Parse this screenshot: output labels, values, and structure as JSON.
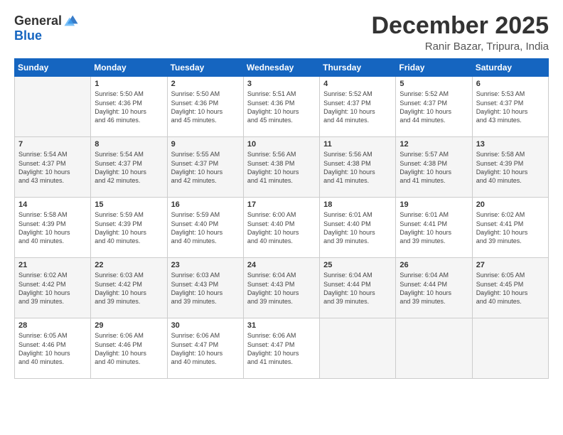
{
  "logo": {
    "general": "General",
    "blue": "Blue"
  },
  "title": {
    "month_year": "December 2025",
    "location": "Ranir Bazar, Tripura, India"
  },
  "days_of_week": [
    "Sunday",
    "Monday",
    "Tuesday",
    "Wednesday",
    "Thursday",
    "Friday",
    "Saturday"
  ],
  "weeks": [
    [
      {
        "day": "",
        "info": ""
      },
      {
        "day": "1",
        "info": "Sunrise: 5:50 AM\nSunset: 4:36 PM\nDaylight: 10 hours\nand 46 minutes."
      },
      {
        "day": "2",
        "info": "Sunrise: 5:50 AM\nSunset: 4:36 PM\nDaylight: 10 hours\nand 45 minutes."
      },
      {
        "day": "3",
        "info": "Sunrise: 5:51 AM\nSunset: 4:36 PM\nDaylight: 10 hours\nand 45 minutes."
      },
      {
        "day": "4",
        "info": "Sunrise: 5:52 AM\nSunset: 4:37 PM\nDaylight: 10 hours\nand 44 minutes."
      },
      {
        "day": "5",
        "info": "Sunrise: 5:52 AM\nSunset: 4:37 PM\nDaylight: 10 hours\nand 44 minutes."
      },
      {
        "day": "6",
        "info": "Sunrise: 5:53 AM\nSunset: 4:37 PM\nDaylight: 10 hours\nand 43 minutes."
      }
    ],
    [
      {
        "day": "7",
        "info": "Sunrise: 5:54 AM\nSunset: 4:37 PM\nDaylight: 10 hours\nand 43 minutes."
      },
      {
        "day": "8",
        "info": "Sunrise: 5:54 AM\nSunset: 4:37 PM\nDaylight: 10 hours\nand 42 minutes."
      },
      {
        "day": "9",
        "info": "Sunrise: 5:55 AM\nSunset: 4:37 PM\nDaylight: 10 hours\nand 42 minutes."
      },
      {
        "day": "10",
        "info": "Sunrise: 5:56 AM\nSunset: 4:38 PM\nDaylight: 10 hours\nand 41 minutes."
      },
      {
        "day": "11",
        "info": "Sunrise: 5:56 AM\nSunset: 4:38 PM\nDaylight: 10 hours\nand 41 minutes."
      },
      {
        "day": "12",
        "info": "Sunrise: 5:57 AM\nSunset: 4:38 PM\nDaylight: 10 hours\nand 41 minutes."
      },
      {
        "day": "13",
        "info": "Sunrise: 5:58 AM\nSunset: 4:39 PM\nDaylight: 10 hours\nand 40 minutes."
      }
    ],
    [
      {
        "day": "14",
        "info": "Sunrise: 5:58 AM\nSunset: 4:39 PM\nDaylight: 10 hours\nand 40 minutes."
      },
      {
        "day": "15",
        "info": "Sunrise: 5:59 AM\nSunset: 4:39 PM\nDaylight: 10 hours\nand 40 minutes."
      },
      {
        "day": "16",
        "info": "Sunrise: 5:59 AM\nSunset: 4:40 PM\nDaylight: 10 hours\nand 40 minutes."
      },
      {
        "day": "17",
        "info": "Sunrise: 6:00 AM\nSunset: 4:40 PM\nDaylight: 10 hours\nand 40 minutes."
      },
      {
        "day": "18",
        "info": "Sunrise: 6:01 AM\nSunset: 4:40 PM\nDaylight: 10 hours\nand 39 minutes."
      },
      {
        "day": "19",
        "info": "Sunrise: 6:01 AM\nSunset: 4:41 PM\nDaylight: 10 hours\nand 39 minutes."
      },
      {
        "day": "20",
        "info": "Sunrise: 6:02 AM\nSunset: 4:41 PM\nDaylight: 10 hours\nand 39 minutes."
      }
    ],
    [
      {
        "day": "21",
        "info": "Sunrise: 6:02 AM\nSunset: 4:42 PM\nDaylight: 10 hours\nand 39 minutes."
      },
      {
        "day": "22",
        "info": "Sunrise: 6:03 AM\nSunset: 4:42 PM\nDaylight: 10 hours\nand 39 minutes."
      },
      {
        "day": "23",
        "info": "Sunrise: 6:03 AM\nSunset: 4:43 PM\nDaylight: 10 hours\nand 39 minutes."
      },
      {
        "day": "24",
        "info": "Sunrise: 6:04 AM\nSunset: 4:43 PM\nDaylight: 10 hours\nand 39 minutes."
      },
      {
        "day": "25",
        "info": "Sunrise: 6:04 AM\nSunset: 4:44 PM\nDaylight: 10 hours\nand 39 minutes."
      },
      {
        "day": "26",
        "info": "Sunrise: 6:04 AM\nSunset: 4:44 PM\nDaylight: 10 hours\nand 39 minutes."
      },
      {
        "day": "27",
        "info": "Sunrise: 6:05 AM\nSunset: 4:45 PM\nDaylight: 10 hours\nand 40 minutes."
      }
    ],
    [
      {
        "day": "28",
        "info": "Sunrise: 6:05 AM\nSunset: 4:46 PM\nDaylight: 10 hours\nand 40 minutes."
      },
      {
        "day": "29",
        "info": "Sunrise: 6:06 AM\nSunset: 4:46 PM\nDaylight: 10 hours\nand 40 minutes."
      },
      {
        "day": "30",
        "info": "Sunrise: 6:06 AM\nSunset: 4:47 PM\nDaylight: 10 hours\nand 40 minutes."
      },
      {
        "day": "31",
        "info": "Sunrise: 6:06 AM\nSunset: 4:47 PM\nDaylight: 10 hours\nand 41 minutes."
      },
      {
        "day": "",
        "info": ""
      },
      {
        "day": "",
        "info": ""
      },
      {
        "day": "",
        "info": ""
      }
    ]
  ]
}
